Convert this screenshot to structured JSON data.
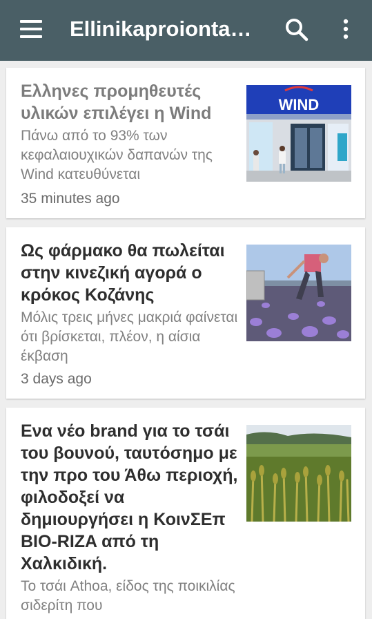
{
  "app_bar": {
    "title": "Ellinikaproionta.gr",
    "menu_icon": "menu-icon",
    "search_icon": "search-icon",
    "more_icon": "more-vert-icon",
    "color": "#4a5f66"
  },
  "articles": [
    {
      "headline": "Ελληνες προμηθευτές υλικών επιλέγει η Wind",
      "summary": "Πάνω από το 93% των κεφαλαιουχικών δαπανών της Wind κατευθύνεται",
      "time": "35 minutes ago",
      "image_text": "WIND",
      "read": true
    },
    {
      "headline": "Ως φάρμακο θα πωλείται στην κινεζική αγορά ο κρόκος Κοζάνης",
      "summary": "Μόλις τρεις μήνες μακριά φαίνεται ότι βρίσκεται, πλέον, η αίσια έκβαση",
      "time": "3 days ago",
      "read": false
    },
    {
      "headline": "Ενα νέο brand για το τσάι του βουνού, ταυτόσημο με την προ του Άθω περιοχή, φιλοδοξεί να δημιουργήσει η ΚοινΣΕπ BIO-RIZA από τη Χαλκιδική.",
      "summary": "Το τσάι Athoa, είδος της ποικιλίας σιδερίτη που",
      "read": false
    }
  ]
}
